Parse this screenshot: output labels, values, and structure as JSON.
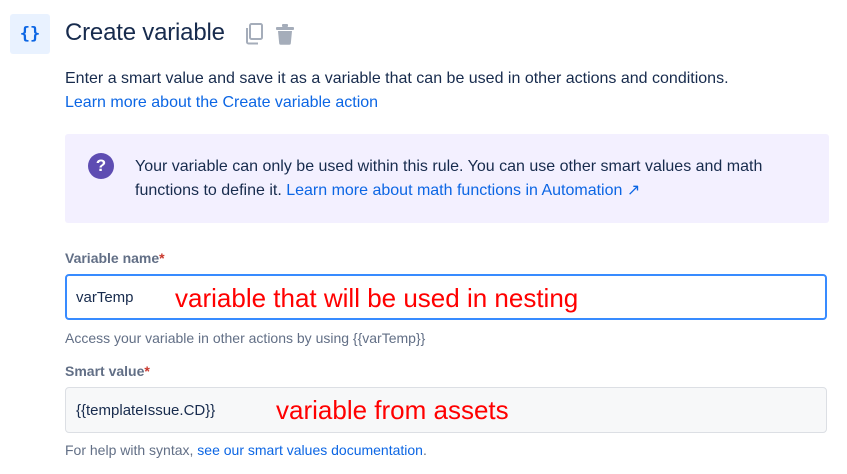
{
  "header": {
    "icon_text": "{}",
    "title": "Create variable",
    "icons": [
      "copy-icon",
      "trash-icon"
    ]
  },
  "description": {
    "text": "Enter a smart value and save it as a variable that can be used in other actions and conditions.",
    "link": "Learn more about the Create variable action"
  },
  "info": {
    "icon": "?",
    "text": "Your variable can only be used within this rule. You can use other smart values and math functions to define it. ",
    "link": "Learn more about math functions in Automation",
    "link_arrow": "↗"
  },
  "variable_name": {
    "label": "Variable name",
    "required_mark": "*",
    "value": "varTemp",
    "annotation": "variable that will be used in nesting",
    "helper": "Access your variable in other actions by using {{varTemp}}"
  },
  "smart_value": {
    "label": "Smart value",
    "required_mark": "*",
    "value": "{{templateIssue.CD}}",
    "annotation": "variable from assets",
    "helper_prefix": "For help with syntax, ",
    "helper_link": "see our smart values documentation",
    "helper_suffix": "."
  },
  "colors": {
    "accent": "#0c66e4",
    "annotation": "#ff0000",
    "info_bg": "#f3f0ff",
    "info_icon": "#5e4db2",
    "required": "#c9372c"
  }
}
